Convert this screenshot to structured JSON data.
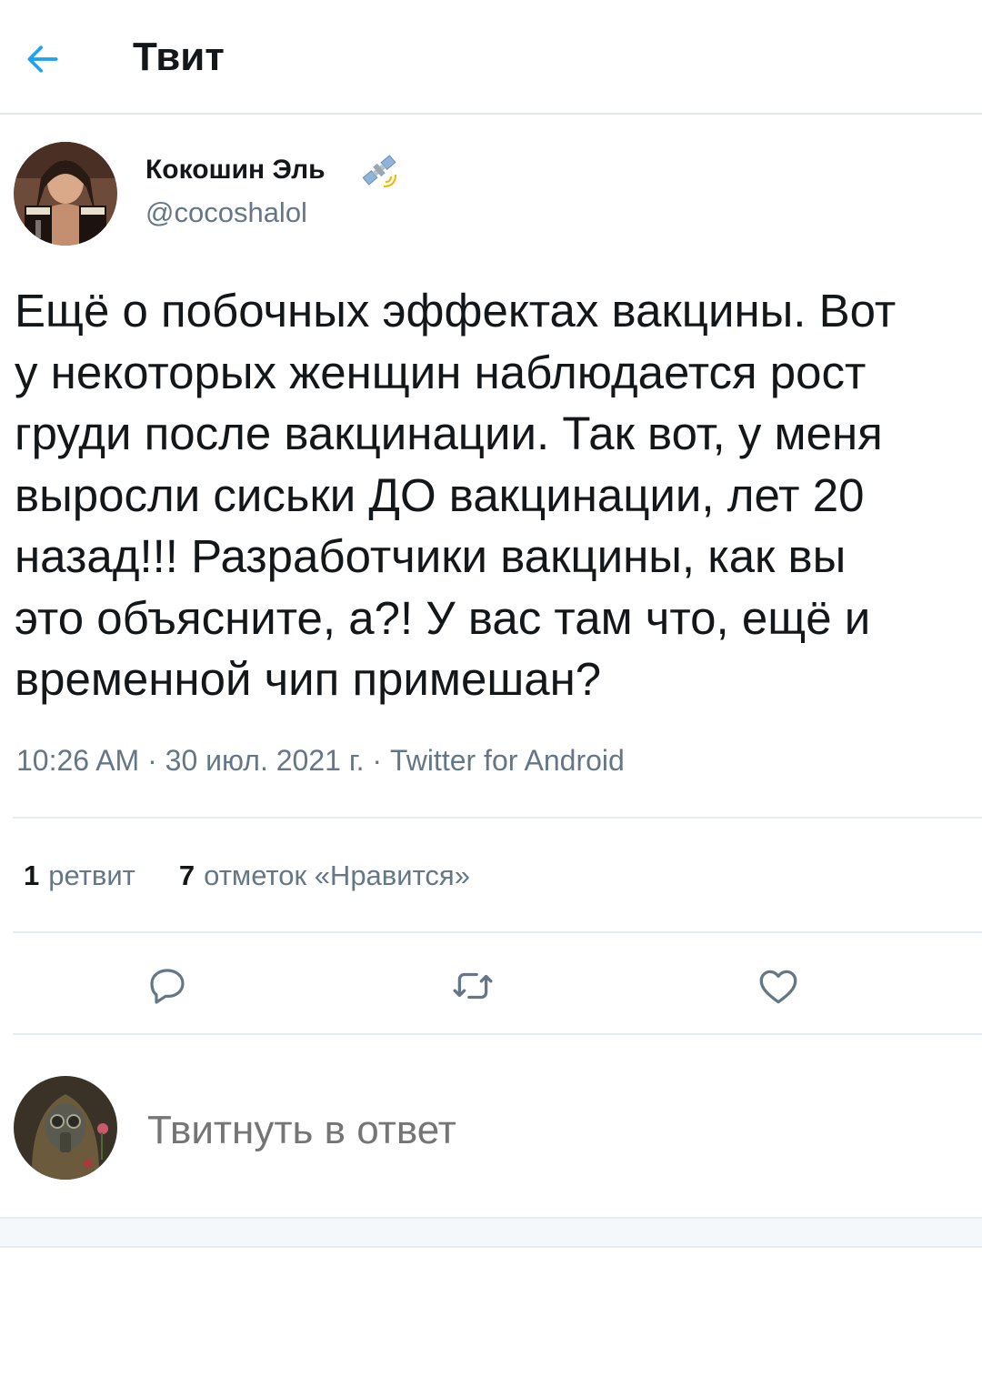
{
  "header": {
    "title": "Твит",
    "back_icon": "back-arrow-icon",
    "accent_color": "#1da1f2"
  },
  "tweet": {
    "author_name": "Кокошин Эль",
    "author_badge_icon": "satellite-icon",
    "author_handle": "@cocoshalol",
    "text_lines": [
      "Ещё о побочных эффектах вакцины. Вот",
      "у некоторых женщин наблюдается рост",
      "груди после вакцинации. Так вот, у меня",
      "выросли сиськи ДО вакцинации, лет 20",
      "назад!!! Разработчики вакцины, как вы",
      "это объясните, а?! У вас там что, ещё и",
      "временной чип примешан?"
    ],
    "meta": "10:26 AM · 30 июл. 2021 г. · Twitter for Android",
    "stats": {
      "retweets_count": "1",
      "retweets_label": "ретвит",
      "likes_count": "7",
      "likes_label": "отметок «Нравится»"
    },
    "actions": {
      "reply_icon": "reply-icon",
      "retweet_icon": "retweet-icon",
      "like_icon": "heart-icon"
    }
  },
  "reply": {
    "placeholder": "Твитнуть в ответ"
  },
  "colors": {
    "text_primary": "#14171a",
    "text_secondary": "#657786",
    "divider": "#e6ecf0"
  }
}
